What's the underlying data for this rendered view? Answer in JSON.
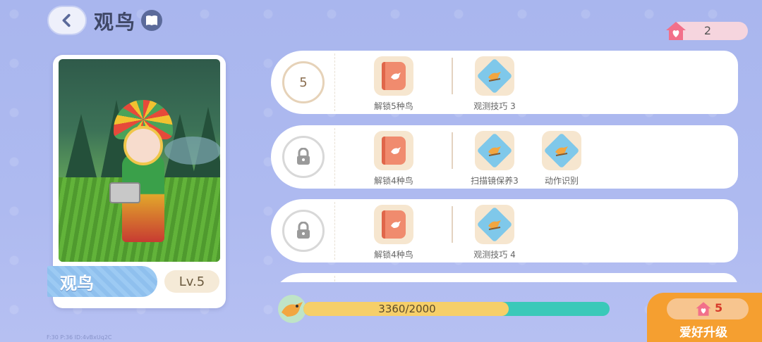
{
  "header": {
    "title": "观鸟"
  },
  "currency": {
    "hearts": "2"
  },
  "card": {
    "name": "观鸟",
    "level": "Lv.5"
  },
  "rows": [
    {
      "badge": "5",
      "locked": false,
      "rewards": [
        {
          "icon": "bird-book-icon",
          "label": "解锁5种鸟"
        },
        {
          "icon": "bird-skill-icon",
          "label": "观测技巧 3"
        }
      ]
    },
    {
      "badge": "",
      "locked": true,
      "rewards": [
        {
          "icon": "bird-book-icon",
          "label": "解锁4种鸟"
        },
        {
          "icon": "bird-skill-icon",
          "label": "扫描镜保养3"
        },
        {
          "icon": "bird-skill-icon",
          "label": "动作识别"
        }
      ]
    },
    {
      "badge": "",
      "locked": true,
      "rewards": [
        {
          "icon": "bird-book-icon",
          "label": "解锁4种鸟"
        },
        {
          "icon": "bird-skill-icon",
          "label": "观测技巧 4"
        }
      ]
    }
  ],
  "progress": {
    "current": 3360,
    "max": 2000,
    "text": "3360/2000",
    "fill_fraction": 0.67
  },
  "upgrade": {
    "cost": "5",
    "label": "爱好升级"
  },
  "debug_text": "F:30  P:36  ID:4vBxUq2C",
  "colors": {
    "accent": "#f59f30",
    "progress_fill": "#f6cf69",
    "progress_track": "#3ac9b9"
  }
}
